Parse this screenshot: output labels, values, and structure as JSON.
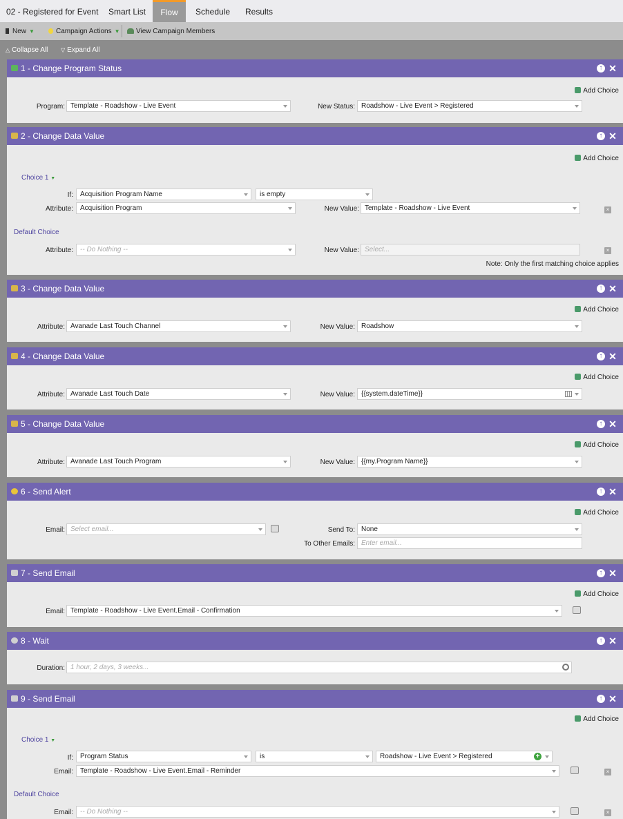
{
  "tabs": {
    "t0": "02 - Registered for Event",
    "t1": "Smart List",
    "t2": "Flow",
    "t3": "Schedule",
    "t4": "Results"
  },
  "toolbar": {
    "new": "New",
    "campaign_actions": "Campaign Actions",
    "view_members": "View Campaign Members"
  },
  "collapse": {
    "collapse_all": "Collapse All",
    "expand_all": "Expand All"
  },
  "common": {
    "add_choice": "Add Choice",
    "choice1": "Choice 1",
    "default_choice": "Default Choice",
    "if": "If:",
    "attribute": "Attribute:",
    "new_value": "New Value:",
    "email": "Email:",
    "note": "Note: Only the first matching choice applies"
  },
  "colors": {
    "header": "#7265b1",
    "active_tab_accent": "#f39a28",
    "body": "#eaeaea",
    "background": "#8c8c8c"
  },
  "steps": {
    "s1": {
      "title": "1 - Change Program Status",
      "icon": "program-status-icon",
      "program_label": "Program:",
      "program": "Template - Roadshow - Live Event",
      "status_label": "New Status:",
      "status": "Roadshow - Live Event > Registered"
    },
    "s2": {
      "title": "2 - Change Data Value",
      "icon": "data-value-icon",
      "if_field": "Acquisition Program Name",
      "if_op": "is empty",
      "attr": "Acquisition Program",
      "value": "Template - Roadshow - Live Event",
      "default_attr": "-- Do Nothing --",
      "default_value": "Select..."
    },
    "s3": {
      "title": "3 - Change Data Value",
      "icon": "data-value-icon",
      "attr": "Avanade Last Touch Channel",
      "value": "Roadshow"
    },
    "s4": {
      "title": "4 - Change Data Value",
      "icon": "data-value-icon",
      "attr": "Avanade Last Touch Date",
      "value": "{{system.dateTime}}"
    },
    "s5": {
      "title": "5 - Change Data Value",
      "icon": "data-value-icon",
      "attr": "Avanade Last Touch Program",
      "value": "{{my.Program Name}}"
    },
    "s6": {
      "title": "6 - Send Alert",
      "icon": "alert-icon",
      "email_ph": "Select email...",
      "send_to_label": "Send To:",
      "send_to": "None",
      "other_label": "To Other Emails:",
      "other_ph": "Enter email..."
    },
    "s7": {
      "title": "7 - Send Email",
      "icon": "email-icon",
      "email": "Template - Roadshow - Live Event.Email - Confirmation"
    },
    "s8": {
      "title": "8 - Wait",
      "icon": "clock-icon",
      "duration_label": "Duration:",
      "duration_ph": "1 hour, 2 days, 3 weeks..."
    },
    "s9": {
      "title": "9 - Send Email",
      "icon": "email-icon",
      "if_field": "Program Status",
      "if_op": "is",
      "if_value": "Roadshow - Live Event > Registered",
      "email": "Template - Roadshow - Live Event.Email - Reminder",
      "default_email": "-- Do Nothing --"
    }
  }
}
